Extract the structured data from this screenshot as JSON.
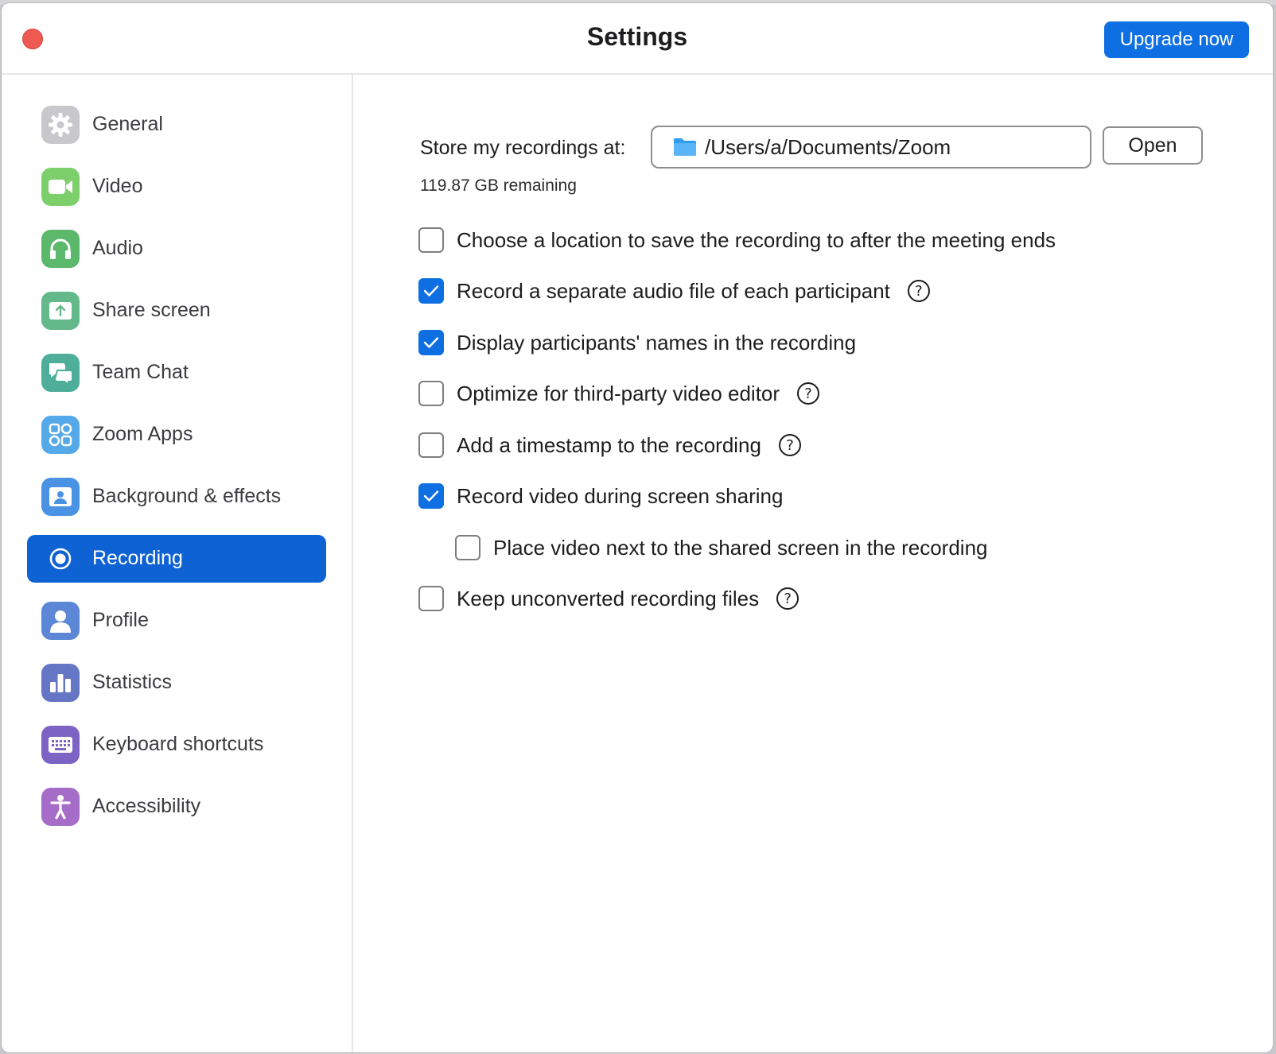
{
  "window": {
    "title": "Settings",
    "upgrade_label": "Upgrade now"
  },
  "sidebar": {
    "items": [
      {
        "label": "General",
        "icon": "gear-icon",
        "color": "#c7c7cc",
        "active": false
      },
      {
        "label": "Video",
        "icon": "video-camera-icon",
        "color": "#7ccf6b",
        "active": false
      },
      {
        "label": "Audio",
        "icon": "headphones-icon",
        "color": "#5cb86a",
        "active": false
      },
      {
        "label": "Share screen",
        "icon": "share-screen-icon",
        "color": "#63b98a",
        "active": false
      },
      {
        "label": "Team Chat",
        "icon": "chat-bubbles-icon",
        "color": "#4fae9a",
        "active": false
      },
      {
        "label": "Zoom Apps",
        "icon": "apps-icon",
        "color": "#56a9e8",
        "active": false
      },
      {
        "label": "Background & effects",
        "icon": "background-icon",
        "color": "#4a92e4",
        "active": false
      },
      {
        "label": "Recording",
        "icon": "record-icon",
        "color": "#0e62d4",
        "active": true
      },
      {
        "label": "Profile",
        "icon": "profile-icon",
        "color": "#5b87d6",
        "active": false
      },
      {
        "label": "Statistics",
        "icon": "bar-chart-icon",
        "color": "#6576c4",
        "active": false
      },
      {
        "label": "Keyboard shortcuts",
        "icon": "keyboard-icon",
        "color": "#7d63c4",
        "active": false
      },
      {
        "label": "Accessibility",
        "icon": "accessibility-icon",
        "color": "#a56cc8",
        "active": false
      }
    ]
  },
  "recording": {
    "store_label": "Store my recordings at:",
    "path": "/Users/a/Documents/Zoom",
    "open_label": "Open",
    "remaining": "119.87 GB remaining",
    "options": [
      {
        "label": "Choose a location to save the recording to after the meeting ends",
        "checked": false,
        "help": false
      },
      {
        "label": "Record a separate audio file of each participant",
        "checked": true,
        "help": true
      },
      {
        "label": "Display participants' names in the recording",
        "checked": true,
        "help": false
      },
      {
        "label": "Optimize for third-party video editor",
        "checked": false,
        "help": true
      },
      {
        "label": "Add a timestamp to the recording",
        "checked": false,
        "help": true
      },
      {
        "label": "Record video during screen sharing",
        "checked": true,
        "help": false
      },
      {
        "label": "Place video next to the shared screen in the recording",
        "checked": false,
        "help": false
      },
      {
        "label": "Keep unconverted recording files",
        "checked": false,
        "help": true
      }
    ],
    "help_glyph": "?"
  },
  "colors": {
    "accent": "#0e6fe2",
    "close": "#ee5a52"
  }
}
